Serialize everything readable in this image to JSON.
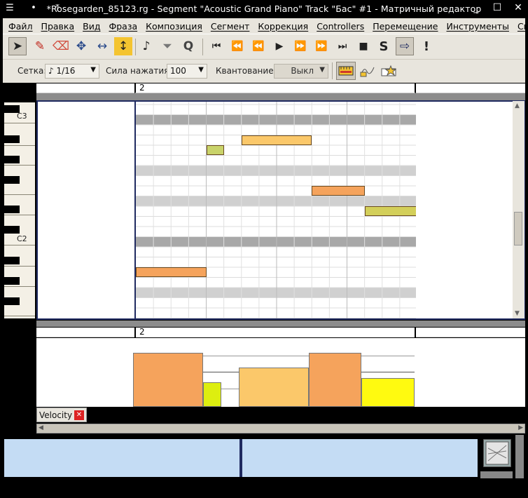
{
  "window": {
    "title": "*Rosegarden_85123.rg - Segment \"Acoustic Grand Piano\" Track \"Бас\" #1 - Матричный редактор",
    "left_controls": [
      "☰",
      "•",
      "⤒"
    ],
    "right_controls": [
      "_",
      "☐",
      "✕"
    ]
  },
  "menu": [
    {
      "label": "Файл"
    },
    {
      "label": "Правка"
    },
    {
      "label": "Вид"
    },
    {
      "label": "Фраза"
    },
    {
      "label": "Композиция"
    },
    {
      "label": "Сегмент"
    },
    {
      "label": "Коррекция"
    },
    {
      "label": "Controllers"
    },
    {
      "label": "Перемещение"
    },
    {
      "label": "Инструменты"
    },
    {
      "label": "Справка"
    }
  ],
  "toolbar": {
    "tools": [
      {
        "name": "select-tool-icon",
        "glyph": "➤",
        "active": true
      },
      {
        "name": "draw-tool-icon",
        "glyph": "✎"
      },
      {
        "name": "erase-tool-icon",
        "glyph": "⌫"
      },
      {
        "name": "move-tool-icon",
        "glyph": "✥"
      },
      {
        "name": "resize-tool-icon",
        "glyph": "↔"
      },
      {
        "name": "velocity-tool-icon",
        "glyph": "↕"
      }
    ],
    "edit_tools": [
      {
        "name": "step-record-icon",
        "glyph": "♪"
      },
      {
        "name": "filter-icon",
        "glyph": "⏷"
      },
      {
        "name": "quantize-icon",
        "glyph": "Q"
      }
    ],
    "transport": [
      {
        "name": "goto-start-icon",
        "glyph": "⏮"
      },
      {
        "name": "rewind-icon",
        "glyph": "⏪"
      },
      {
        "name": "rewind-fast-icon",
        "glyph": "⏪"
      },
      {
        "name": "play-icon",
        "glyph": "▶"
      },
      {
        "name": "forward-fast-icon",
        "glyph": "⏩"
      },
      {
        "name": "forward-icon",
        "glyph": "⏩"
      },
      {
        "name": "goto-end-icon",
        "glyph": "⏭"
      },
      {
        "name": "stop-icon",
        "glyph": "■"
      },
      {
        "name": "solo-icon",
        "glyph": "S"
      },
      {
        "name": "follow-playhead-icon",
        "glyph": "⇨"
      },
      {
        "name": "panic-icon",
        "glyph": "!"
      }
    ]
  },
  "toolbar2": {
    "grid_label": "Сетка:",
    "grid_value": "♪ 1/16",
    "velocity_label": "Сила нажатия:",
    "velocity_value": "100",
    "quantize_label": "Квантование:",
    "quantize_value": "Выкл"
  },
  "ruler": {
    "bar_number": "2"
  },
  "ruler_lower": {
    "bar_number": "2"
  },
  "piano": {
    "label_c3": "C3",
    "label_c2": "C2"
  },
  "notes": [
    {
      "start": 0.0,
      "length": 0.25,
      "pitch": "row-16",
      "color": "#f5a35c"
    },
    {
      "start": 0.25,
      "length": 0.0625,
      "pitch": "row-4",
      "color": "#c9d36a"
    },
    {
      "start": 0.375,
      "length": 0.25,
      "pitch": "row-3",
      "color": "#fbc86a"
    },
    {
      "start": 0.625,
      "length": 0.1875,
      "pitch": "row-8",
      "color": "#f5a35c"
    },
    {
      "start": 0.8125,
      "length": 0.1875,
      "pitch": "row-10",
      "color": "#d3cf5a"
    }
  ],
  "velocity_bars": [
    {
      "level": 0.79,
      "color": "#f5a35c"
    },
    {
      "level": 0.36,
      "color": "#ddee10"
    },
    {
      "level": 0.57,
      "color": "#fbc86a"
    },
    {
      "level": 0.79,
      "color": "#f5a35c"
    },
    {
      "level": 0.42,
      "color": "#fffa10"
    }
  ],
  "velocity_tab": {
    "label": "Velocity",
    "close_glyph": "✕"
  }
}
